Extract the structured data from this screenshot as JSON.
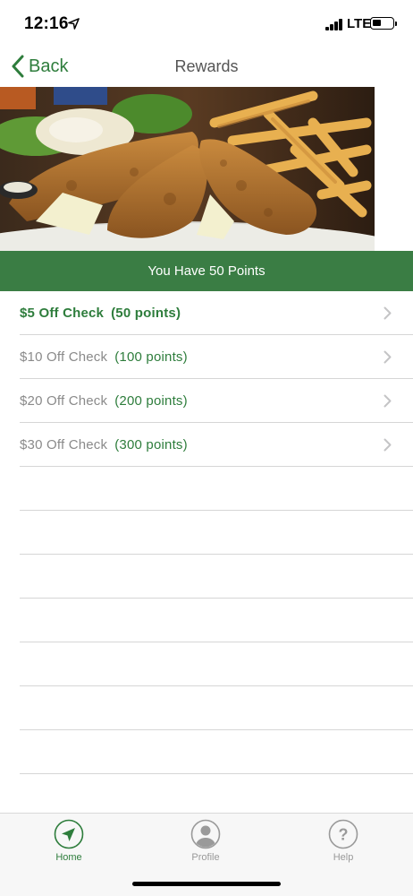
{
  "status_bar": {
    "time": "12:16",
    "network": "LTE",
    "icons": [
      "location-arrow-icon",
      "signal-icon",
      "battery-icon"
    ]
  },
  "nav": {
    "back_label": "Back",
    "title": "Rewards",
    "back_icon": "chevron-left-icon"
  },
  "hero": {
    "image": "fish-and-chips-photo"
  },
  "points_banner": {
    "text": "You Have 50 Points"
  },
  "rewards": [
    {
      "label": "$5 Off Check",
      "points": "(50 points)",
      "available": true
    },
    {
      "label": "$10 Off Check",
      "points": "(100 points)",
      "available": false
    },
    {
      "label": "$20 Off Check",
      "points": "(200 points)",
      "available": false
    },
    {
      "label": "$30 Off Check",
      "points": "(300 points)",
      "available": false
    }
  ],
  "tab_bar": {
    "tabs": [
      {
        "label": "Home",
        "icon": "navigation-arrow-icon",
        "active": true
      },
      {
        "label": "Profile",
        "icon": "person-icon",
        "active": false
      },
      {
        "label": "Help",
        "icon": "question-icon",
        "active": false
      }
    ]
  },
  "colors": {
    "accent": "#3a7d44",
    "accent_text": "#2e7d3c",
    "muted_text": "#8a8a8a",
    "divider": "#d6d6d6"
  }
}
